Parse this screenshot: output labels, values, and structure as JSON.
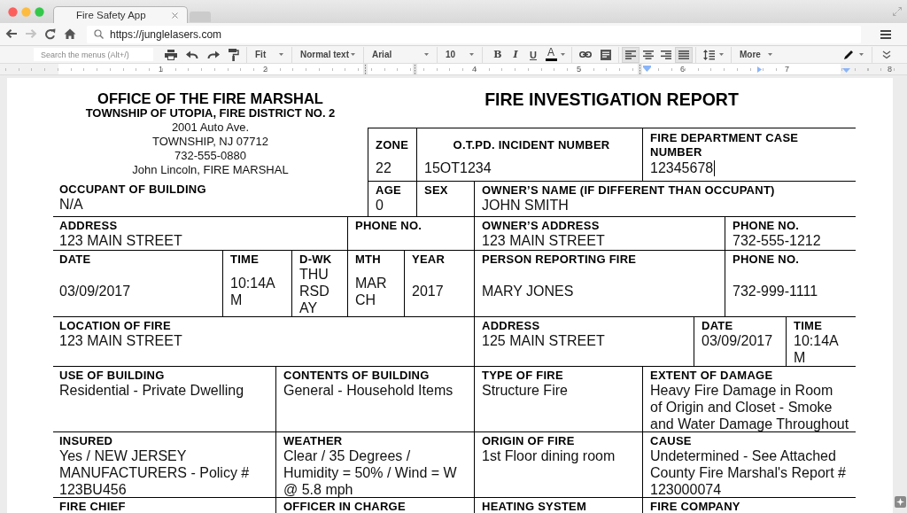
{
  "browser": {
    "tabs": [
      {
        "title": "Fire Safety App",
        "selected": true
      }
    ],
    "nav_buttons": [
      {
        "kind": "back",
        "disabled": false
      },
      {
        "kind": "forward",
        "disabled": true
      },
      {
        "kind": "reload",
        "disabled": false
      },
      {
        "kind": "home",
        "disabled": false
      }
    ],
    "url": "https://junglelasers.com"
  },
  "toolbar": {
    "search": {
      "placeholder": "Search the menus (Alt+/)"
    },
    "dropdowns": [
      {
        "kind": "zoom",
        "value": "Fit"
      },
      {
        "kind": "style",
        "value": "Normal text"
      },
      {
        "kind": "font",
        "value": "Arial"
      },
      {
        "kind": "size",
        "value": "10"
      }
    ],
    "format_buttons": [
      {
        "kind": "bold",
        "label": "B"
      },
      {
        "kind": "italic",
        "label": "I"
      },
      {
        "kind": "underline",
        "label": "U"
      },
      {
        "kind": "text-color",
        "label": "A"
      }
    ],
    "align_buttons": [
      {
        "kind": "left",
        "selected": true
      },
      {
        "kind": "center",
        "selected": false
      },
      {
        "kind": "right",
        "selected": false
      },
      {
        "kind": "justify",
        "selected": true
      }
    ],
    "more": "More"
  },
  "ruler": {
    "labels": [
      "1",
      "2",
      "4",
      "5",
      "6",
      "7",
      "8"
    ]
  },
  "document": {
    "office": {
      "title": "OFFICE OF THE FIRE MARSHAL",
      "subtitle": "TOWNSHIP OF UTOPIA, FIRE DISTRICT NO. 2",
      "lines": [
        "2001 Auto Ave.",
        "TOWNSHIP, NJ 07712",
        "732-555-0880",
        "John Lincoln, FIRE MARSHAL"
      ]
    },
    "report_title": "FIRE INVESTIGATION REPORT",
    "case_box": {
      "fields": [
        {
          "label": "ZONE",
          "value": "22",
          "caret": false
        },
        {
          "label": "O.T.PD. INCIDENT NUMBER",
          "value": "15OT1234",
          "caret": false
        },
        {
          "label": "FIRE DEPARTMENT CASE NUMBER",
          "value": "12345678",
          "caret": true
        }
      ]
    },
    "form_lines": [
      {
        "fields": [
          {
            "label": "OCCUPANT OF BUILDING",
            "value": "N/A"
          },
          {
            "label": "AGE",
            "value": "0"
          },
          {
            "label": "SEX"
          },
          {
            "label": "OWNER’S NAME (IF DIFFERENT THAN OCCUPANT)",
            "value": "JOHN SMITH"
          }
        ]
      },
      {
        "fields": [
          {
            "label": "ADDRESS",
            "value": "123 MAIN STREET"
          },
          {
            "label": "PHONE NO."
          },
          {
            "label": "OWNER’S ADDRESS",
            "value": "123 MAIN STREET"
          },
          {
            "label": "PHONE NO.",
            "value": "732-555-1212"
          }
        ]
      },
      {
        "fields": [
          {
            "label": "DATE",
            "value": "03/09/2017"
          },
          {
            "label": "TIME",
            "value": "10:14AM"
          },
          {
            "label": "D-WK",
            "value": "THURSDAY"
          },
          {
            "label": "MTH",
            "value": "MARCH"
          },
          {
            "label": "YEAR",
            "value": "2017"
          },
          {
            "label": "PERSON REPORTING FIRE",
            "value": "MARY JONES"
          },
          {
            "label": "PHONE NO.",
            "value": "732-999-1111"
          }
        ]
      },
      {
        "fields": [
          {
            "label": "LOCATION OF FIRE",
            "value": "123 MAIN STREET"
          },
          {
            "label": "ADDRESS",
            "value": "125 MAIN STREET"
          },
          {
            "label": "DATE",
            "value": "03/09/2017"
          },
          {
            "label": "TIME",
            "value": "10:14AM"
          }
        ]
      },
      {
        "fields": [
          {
            "label": "USE OF BUILDING",
            "value": "Residential - Private Dwelling"
          },
          {
            "label": "CONTENTS OF BUILDING",
            "value": "General - Household Items"
          },
          {
            "label": "TYPE OF FIRE",
            "value": "Structure Fire"
          },
          {
            "label": "EXTENT OF DAMAGE",
            "value": "Heavy Fire Damage in Room\nof Origin and Closet - Smoke\nand Water Damage Throughout"
          }
        ]
      },
      {
        "fields": [
          {
            "label": "INSURED",
            "value": "Yes / NEW JERSEY\nMANUFACTURERS - Policy #\n123BU456"
          },
          {
            "label": "WEATHER",
            "value": "Clear / 35 Degrees /\nHumidity = 50% / Wind = W\n@ 5.8 mph"
          },
          {
            "label": "ORIGIN OF FIRE",
            "value": "1st Floor dining room"
          },
          {
            "label": "CAUSE",
            "value": "Undetermined - See Attached\nCounty Fire Marshal's Report #\n123000074"
          }
        ]
      },
      {
        "fields": [
          {
            "label": "FIRE CHIEF"
          },
          {
            "label": "OFFICER IN CHARGE"
          },
          {
            "label": "HEATING SYSTEM"
          },
          {
            "label": "FIRE COMPANY"
          }
        ]
      }
    ]
  }
}
